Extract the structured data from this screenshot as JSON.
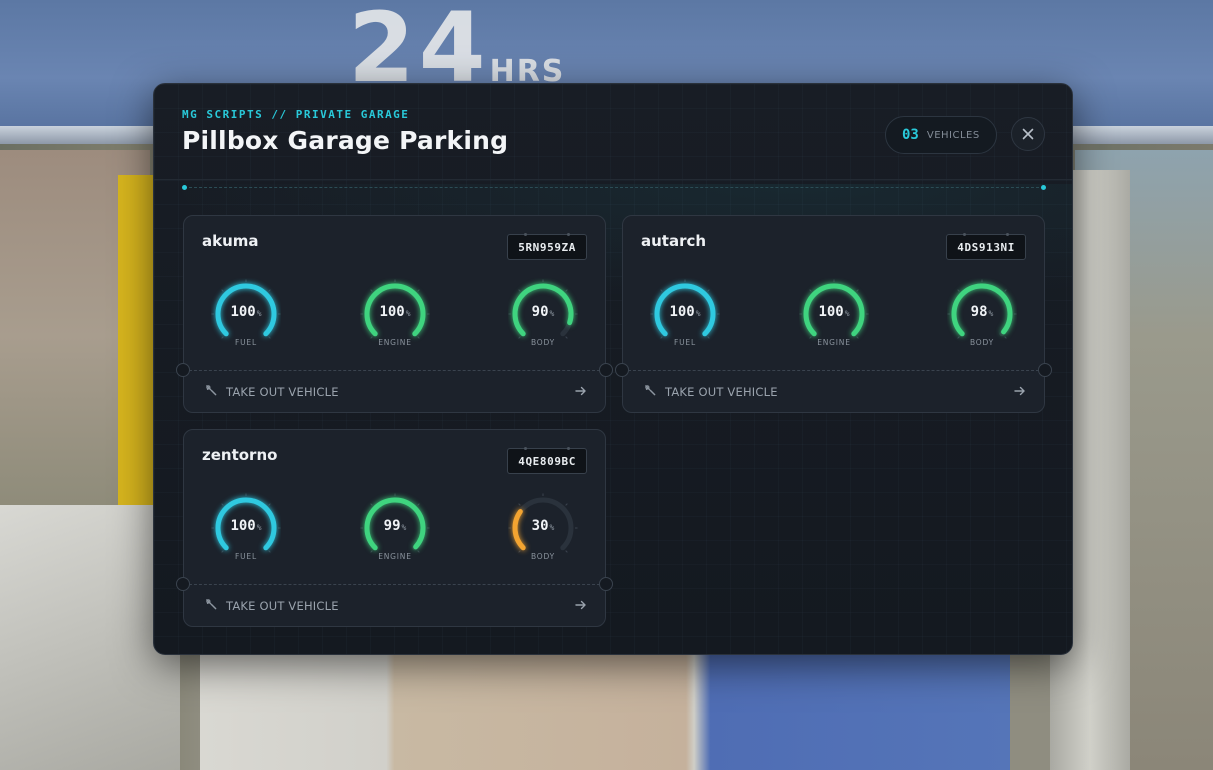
{
  "header": {
    "eyebrow": "MG SCRIPTS // PRIVATE GARAGE",
    "title": "Pillbox Garage Parking",
    "vehicle_count": "03",
    "vehicle_count_label": "VEHICLES",
    "close_icon": "close-icon"
  },
  "colors": {
    "accent": "#29c9d9",
    "fuel": "#2fc9e0",
    "good": "#3fd47f",
    "warn": "#f3a431",
    "panel_bg": "#161b22",
    "card_bg": "#1c222b"
  },
  "vehicles": [
    {
      "name": "akuma",
      "plate": "5RN959ZA",
      "gauges": [
        {
          "label": "FUEL",
          "value": 100,
          "display": "100",
          "unit": "%"
        },
        {
          "label": "ENGINE",
          "value": 100,
          "display": "100",
          "unit": "%"
        },
        {
          "label": "BODY",
          "value": 90,
          "display": "90",
          "unit": "%"
        }
      ],
      "action_label": "TAKE OUT VEHICLE",
      "action_icon": "wrench-icon",
      "arrow_icon": "arrow-right-icon"
    },
    {
      "name": "autarch",
      "plate": "4DS913NI",
      "gauges": [
        {
          "label": "FUEL",
          "value": 100,
          "display": "100",
          "unit": "%"
        },
        {
          "label": "ENGINE",
          "value": 100,
          "display": "100",
          "unit": "%"
        },
        {
          "label": "BODY",
          "value": 98,
          "display": "98",
          "unit": "%"
        }
      ],
      "action_label": "TAKE OUT VEHICLE",
      "action_icon": "wrench-icon",
      "arrow_icon": "arrow-right-icon"
    },
    {
      "name": "zentorno",
      "plate": "4QE809BC",
      "gauges": [
        {
          "label": "FUEL",
          "value": 100,
          "display": "100",
          "unit": "%"
        },
        {
          "label": "ENGINE",
          "value": 99,
          "display": "99",
          "unit": "%"
        },
        {
          "label": "BODY",
          "value": 30,
          "display": "30",
          "unit": "%"
        }
      ],
      "action_label": "TAKE OUT VEHICLE",
      "action_icon": "wrench-icon",
      "arrow_icon": "arrow-right-icon"
    }
  ]
}
